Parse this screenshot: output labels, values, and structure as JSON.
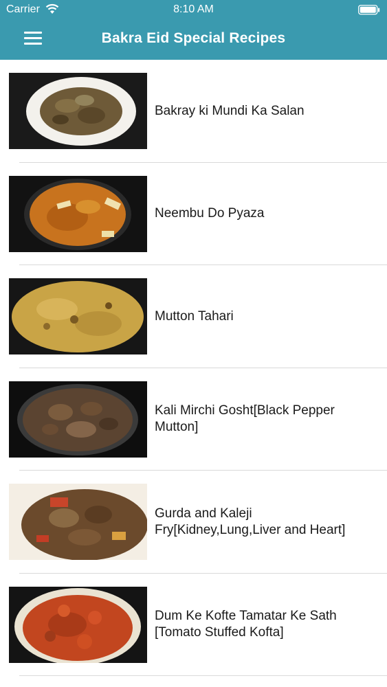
{
  "status_bar": {
    "carrier": "Carrier",
    "time": "8:10 AM"
  },
  "header": {
    "title": "Bakra Eid Special Recipes",
    "menu_icon": "hamburger-menu-icon",
    "bg_color": "#3a9aaf"
  },
  "recipes": [
    {
      "name": "Bakray ki Mundi Ka Salan",
      "image": "mutton-curry-white-plate"
    },
    {
      "name": "Neembu Do Pyaza",
      "image": "orange-curry-with-lemon"
    },
    {
      "name": "Mutton Tahari",
      "image": "yellow-rice-platter"
    },
    {
      "name": "Kali Mirchi Gosht[Black Pepper Mutton]",
      "image": "black-pepper-mutton-glass-bowl"
    },
    {
      "name": "Gurda and Kaleji Fry[Kidney,Lung,Liver and Heart]",
      "image": "fried-organ-meat"
    },
    {
      "name": "Dum Ke Kofte Tamatar Ke Sath [Tomato Stuffed Kofta]",
      "image": "tomato-kofta-curry"
    }
  ]
}
